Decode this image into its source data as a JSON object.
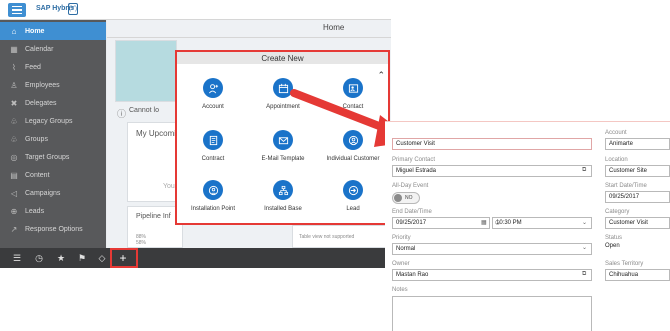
{
  "app": {
    "brand": "SAP Hybris",
    "brand_badge": "(Y)",
    "page_title": "Home"
  },
  "sidebar": {
    "items": [
      {
        "label": "Home",
        "icon": "home-icon"
      },
      {
        "label": "Calendar",
        "icon": "calendar-icon"
      },
      {
        "label": "Feed",
        "icon": "feed-icon"
      },
      {
        "label": "Employees",
        "icon": "person-icon"
      },
      {
        "label": "Delegates",
        "icon": "delegates-icon"
      },
      {
        "label": "Legacy Groups",
        "icon": "group-icon"
      },
      {
        "label": "Groups",
        "icon": "group-icon"
      },
      {
        "label": "Target Groups",
        "icon": "target-icon"
      },
      {
        "label": "Content",
        "icon": "document-icon"
      },
      {
        "label": "Campaigns",
        "icon": "megaphone-icon"
      },
      {
        "label": "Leads",
        "icon": "leads-icon"
      },
      {
        "label": "Response Options",
        "icon": "response-icon"
      }
    ]
  },
  "toolbar": {
    "buttons": [
      "list-icon",
      "clock-icon",
      "star-icon",
      "flag-icon",
      "tag-icon",
      "plus-icon"
    ]
  },
  "tiles": {
    "cannot_load": "Cannot lo",
    "my_upcoming": "My Upcomi",
    "you_prefix": "You",
    "pipeline": "Pipeline Inf",
    "percent_a": "88%",
    "percent_b": "58%",
    "table_not_supported": "Table view not supported"
  },
  "popup": {
    "title": "Create New",
    "items": [
      {
        "label": "Account",
        "icon": "add-person-icon"
      },
      {
        "label": "Appointment",
        "icon": "calendar-icon"
      },
      {
        "label": "Contact",
        "icon": "contact-card-icon"
      },
      {
        "label": "Contract",
        "icon": "contract-icon"
      },
      {
        "label": "E-Mail Template",
        "icon": "email-icon"
      },
      {
        "label": "Individual Customer",
        "icon": "customer-icon"
      },
      {
        "label": "Installation Point",
        "icon": "location-icon"
      },
      {
        "label": "Installed Base",
        "icon": "hierarchy-icon"
      },
      {
        "label": "Lead",
        "icon": "lead-icon"
      }
    ]
  },
  "form": {
    "subject_value": "Customer Visit",
    "primary_contact_label": "Primary Contact",
    "primary_contact_value": "Miguel Estrada",
    "all_day_label": "All-Day Event",
    "all_day_value": "NO",
    "end_label": "End Date/Time",
    "end_date": "09/25/2017",
    "end_time": "10:30 PM",
    "priority_label": "Priority",
    "priority_value": "Normal",
    "owner_label": "Owner",
    "owner_value": "Mastan Rao",
    "notes_label": "Notes",
    "account_label": "Account",
    "account_value": "Animarte",
    "location_label": "Location",
    "location_value": "Customer Site",
    "start_label": "Start Date/Time",
    "start_value": "09/25/2017",
    "category_label": "Category",
    "category_value": "Customer Visit",
    "status_label": "Status",
    "status_value": "Open",
    "territory_label": "Sales Territory",
    "territory_value": "Chihuahua"
  },
  "colors": {
    "sidebar_bg": "#58595b",
    "accent_blue": "#3f8fd2",
    "icon_blue": "#1a73c9",
    "highlight_red": "#e53935"
  }
}
